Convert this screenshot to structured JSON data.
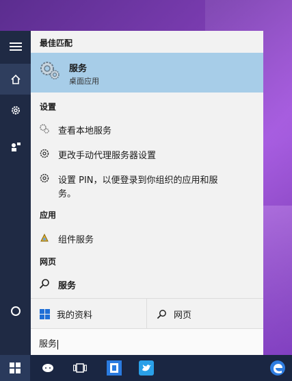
{
  "panel": {
    "best_match_header": "最佳匹配",
    "best_match": {
      "title": "服务",
      "subtitle": "桌面应用",
      "icon": "services-gear-icon"
    },
    "settings_header": "设置",
    "settings_items": [
      {
        "label": "查看本地服务",
        "icon": "local-services-icon"
      },
      {
        "label": "更改手动代理服务器设置",
        "icon": "gear-icon"
      },
      {
        "label_line1": "设置 PIN，以便登录到你组织的应用和服",
        "label_line2": "务。",
        "icon": "gear-icon"
      }
    ],
    "apps_header": "应用",
    "apps_items": [
      {
        "label": "组件服务",
        "icon": "component-services-icon"
      }
    ],
    "web_header": "网页",
    "web_items": [
      {
        "label": "服务",
        "icon": "search-icon"
      }
    ],
    "filters": {
      "my_stuff": "我的资料",
      "web": "网页"
    },
    "search": {
      "value": "服务"
    }
  },
  "colors": {
    "highlight": "#a7cde8",
    "rail": "#1f2a44",
    "taskbar": "#1a2642",
    "panel": "#f2f2f2"
  }
}
